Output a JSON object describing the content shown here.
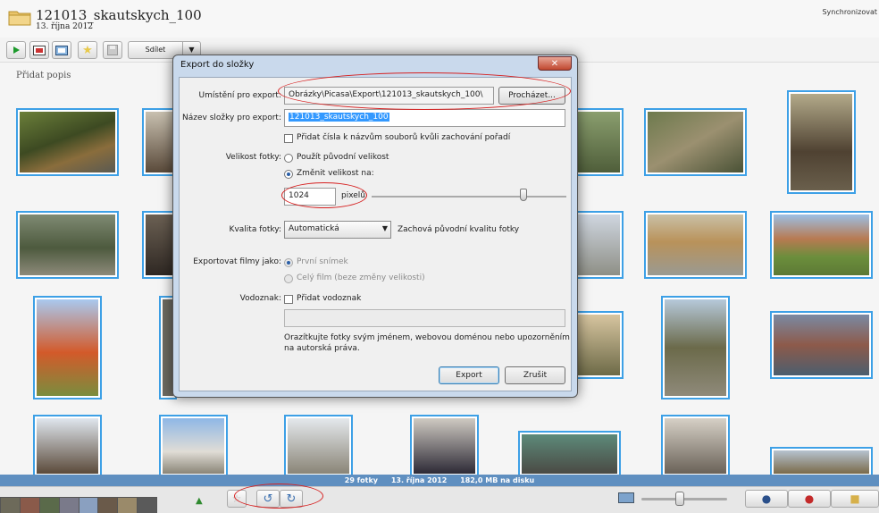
{
  "header": {
    "album_title": "121013_skautskych_100",
    "album_date": "13. října 2012",
    "sync_label": "Synchronizovat"
  },
  "toolbar": {
    "share_label": "Sdílet",
    "add_caption": "Přidat popis"
  },
  "dialog": {
    "title": "Export do složky",
    "location_label": "Umístění pro export:",
    "location_value": "Obrázky\\Picasa\\Export\\121013_skautskych_100\\",
    "browse_label": "Procházet...",
    "folder_name_label": "Název složky pro export:",
    "folder_name_value": "121013_skautskych_100",
    "add_numbers_label": "Přidat čísla k názvům souborů kvůli zachování pořadí",
    "size_label": "Velikost fotky:",
    "use_original_label": "Použít původní velikost",
    "resize_label": "Změnit velikost na:",
    "resize_value": "1024",
    "pixels_label": "pixelů",
    "size_slider_fraction": 0.78,
    "quality_label": "Kvalita fotky:",
    "quality_value": "Automatická",
    "quality_hint": "Zachová původní kvalitu fotky",
    "movies_label": "Exportovat filmy jako:",
    "first_frame_label": "První snímek",
    "full_movie_label": "Celý film (beze změny velikosti)",
    "watermark_label": "Vodoznak:",
    "add_watermark_label": "Přidat vodoznak",
    "watermark_hint": "Orazítkujte fotky svým jménem, webovou doménou nebo upozorněním na autorská práva.",
    "export_label": "Export",
    "cancel_label": "Zrušit"
  },
  "status": {
    "count": "29 fotky",
    "date": "13. října 2012",
    "disk": "182,0 MB na disku"
  },
  "zoom_fraction": 0.45,
  "icons": [
    "folder-icon",
    "play-icon",
    "slideshow-icon",
    "collage-icon",
    "star-icon",
    "save-icon",
    "rotate-left-icon",
    "rotate-right-icon",
    "person-icon",
    "location-pin-icon",
    "tag-icon"
  ],
  "colors": {
    "selection_border": "#3da0e6",
    "status_bar": "#5f8fc0",
    "annotation": "#d62020"
  }
}
